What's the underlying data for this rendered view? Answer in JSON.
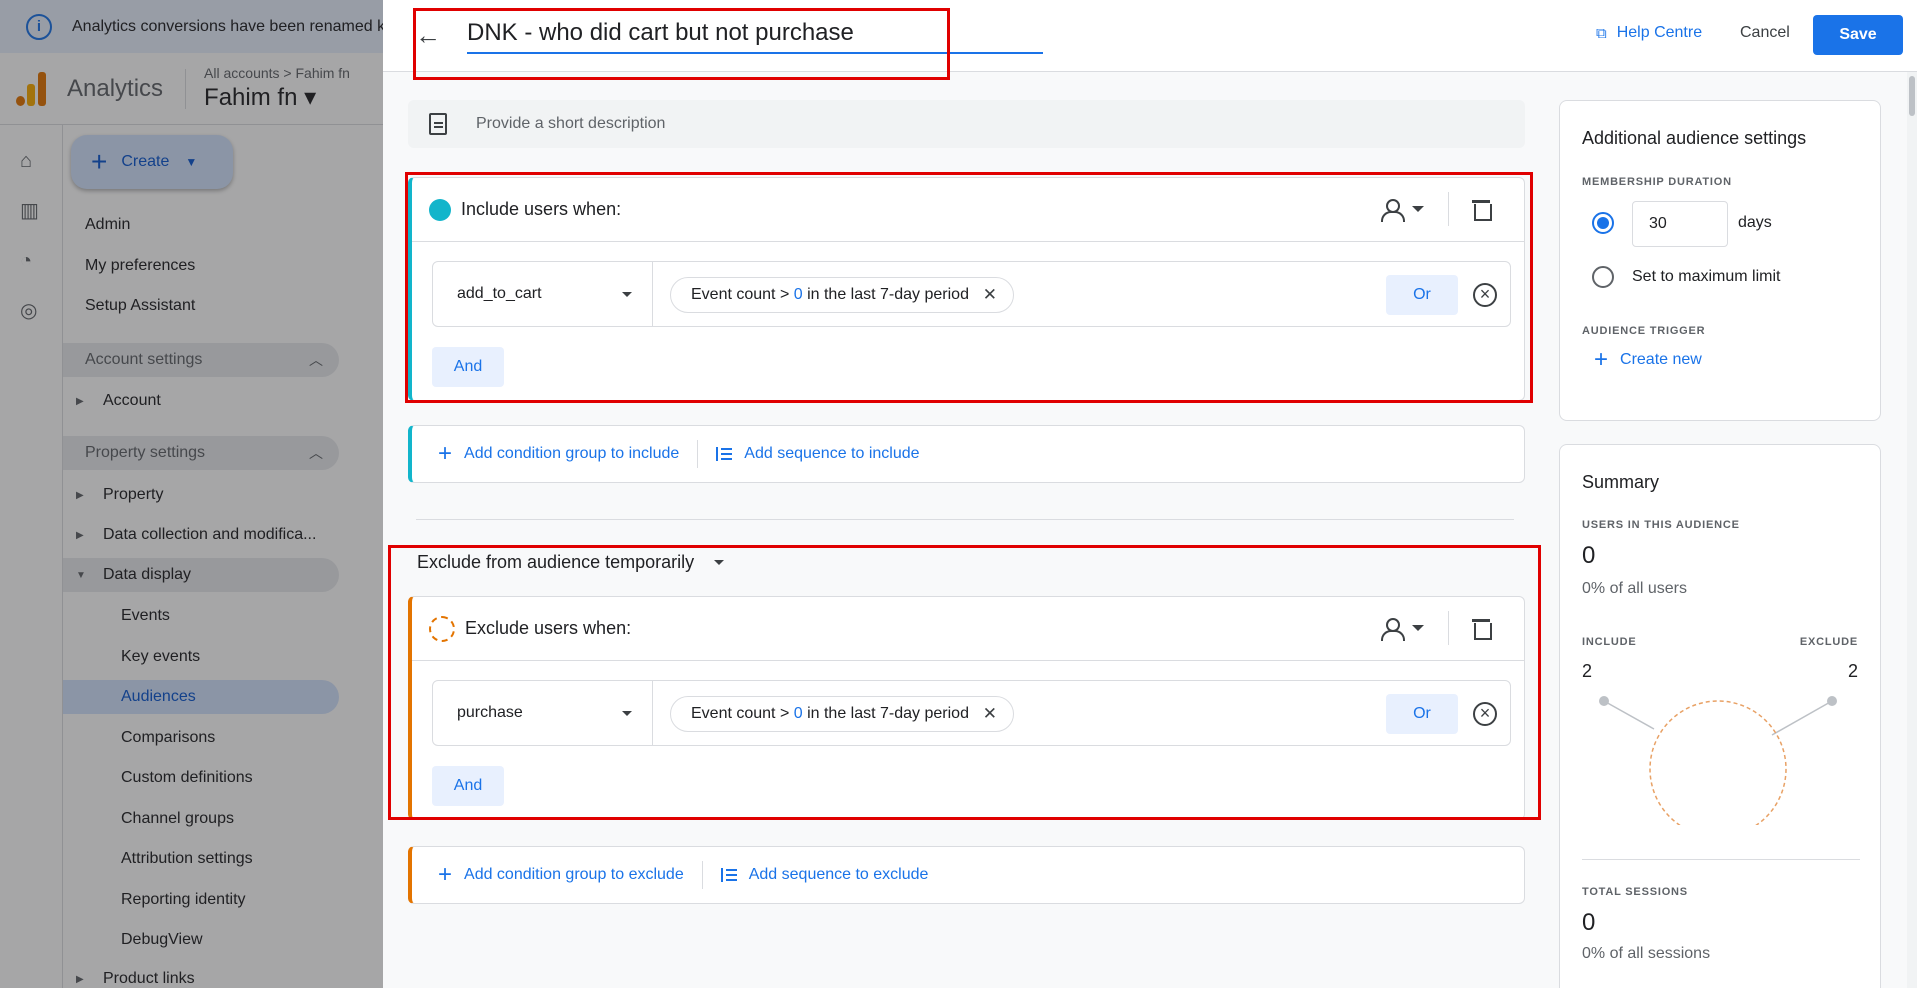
{
  "banner": {
    "text": "Analytics conversions have been renamed k"
  },
  "topbar": {
    "app_name": "Analytics",
    "breadcrumb": "All accounts > Fahim fn",
    "property": "Fahim fn ▾"
  },
  "rail": {
    "icons": [
      "home-icon",
      "reports-icon",
      "explore-icon",
      "advertising-icon"
    ]
  },
  "nav": {
    "create_label": "Create",
    "items": [
      {
        "label": "Admin"
      },
      {
        "label": "My preferences"
      },
      {
        "label": "Setup Assistant"
      },
      {
        "label": "Account settings"
      },
      {
        "label": "Account"
      },
      {
        "label": "Property settings"
      },
      {
        "label": "Property"
      },
      {
        "label": "Data collection and modifica..."
      },
      {
        "label": "Data display"
      },
      {
        "label": "Events"
      },
      {
        "label": "Key events"
      },
      {
        "label": "Audiences"
      },
      {
        "label": "Comparisons"
      },
      {
        "label": "Custom definitions"
      },
      {
        "label": "Channel groups"
      },
      {
        "label": "Attribution settings"
      },
      {
        "label": "Reporting identity"
      },
      {
        "label": "DebugView"
      },
      {
        "label": "Product links"
      }
    ]
  },
  "panel": {
    "title": "DNK - who did cart but not purchase",
    "help_label": "Help Centre",
    "cancel_label": "Cancel",
    "save_label": "Save",
    "description_placeholder": "Provide a short description"
  },
  "include": {
    "header": "Include users when:",
    "event": "add_to_cart",
    "condition_prefix": "Event count > ",
    "condition_value": "0",
    "condition_suffix": " in the last 7-day period",
    "or_label": "Or",
    "and_label": "And",
    "add_group_label": "Add condition group to include",
    "add_sequence_label": "Add sequence to include"
  },
  "exclude": {
    "mode": "Exclude from audience temporarily",
    "header": "Exclude users when:",
    "event": "purchase",
    "condition_prefix": "Event count > ",
    "condition_value": "0",
    "condition_suffix": " in the last 7-day period",
    "or_label": "Or",
    "and_label": "And",
    "add_group_label": "Add condition group to exclude",
    "add_sequence_label": "Add sequence to exclude"
  },
  "settings": {
    "title": "Additional audience settings",
    "membership_caption": "MEMBERSHIP DURATION",
    "days_value": "30",
    "days_unit": "days",
    "max_limit_label": "Set to maximum limit",
    "trigger_caption": "AUDIENCE TRIGGER",
    "create_new_label": "Create new"
  },
  "summary": {
    "title": "Summary",
    "users_caption": "USERS IN THIS AUDIENCE",
    "users_value": "0",
    "users_pct": "0% of all users",
    "include_caption": "INCLUDE",
    "include_value": "2",
    "exclude_caption": "EXCLUDE",
    "exclude_value": "2",
    "sessions_caption": "TOTAL SESSIONS",
    "sessions_value": "0",
    "sessions_pct": "0% of all sessions"
  },
  "colors": {
    "accent": "#1a73e8",
    "include": "#12b5cb",
    "exclude": "#e37400",
    "highlight": "#e00000"
  }
}
